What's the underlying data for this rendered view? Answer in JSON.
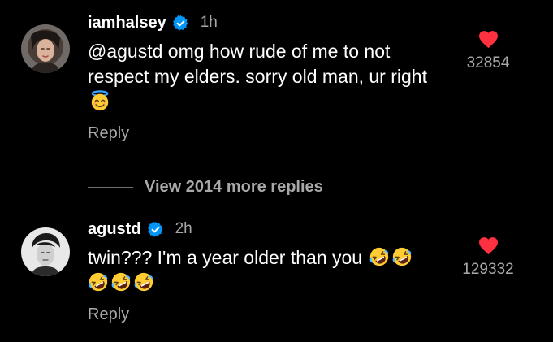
{
  "colors": {
    "background": "#000000",
    "text_primary": "#ffffff",
    "text_secondary": "#a8a8a8",
    "verified_blue": "#0095f6",
    "like_red": "#ff3040"
  },
  "comments": [
    {
      "username": "iamhalsey",
      "verified": true,
      "time": "1h",
      "text": "@agustd omg how rude of me to not respect my elders. sorry old man, ur right",
      "emojis": [
        "smiling-face-with-halo"
      ],
      "reply_label": "Reply",
      "liked": true,
      "like_count": "32854",
      "avatar_icon": "avatar-iamhalsey"
    },
    {
      "username": "agustd",
      "verified": true,
      "time": "2h",
      "text_line1": "twin??? I'm a year older than you",
      "emojis_inline": [
        "rolling-on-floor-laughing",
        "rolling-on-floor-laughing"
      ],
      "emojis_line2": [
        "rolling-on-floor-laughing",
        "rolling-on-floor-laughing",
        "rolling-on-floor-laughing"
      ],
      "reply_label": "Reply",
      "liked": true,
      "like_count": "129332",
      "avatar_icon": "avatar-agustd"
    }
  ],
  "thread": {
    "view_more_label": "View 2014 more replies"
  }
}
